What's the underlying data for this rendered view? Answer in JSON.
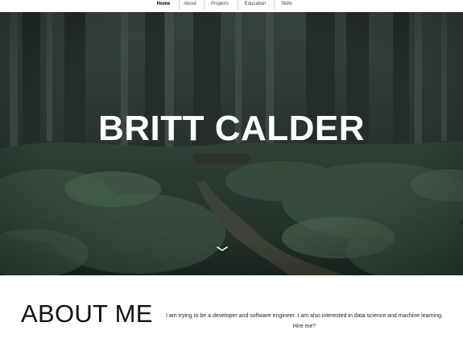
{
  "nav": {
    "items": [
      {
        "label": "Home",
        "active": true
      },
      {
        "label": "About",
        "active": false
      },
      {
        "label": "Projects",
        "active": false
      },
      {
        "label": "Education",
        "active": false
      },
      {
        "label": "Skills",
        "active": false
      }
    ]
  },
  "hero": {
    "title": "BRITT CALDER",
    "scroll_icon": "chevron-down-icon",
    "background": "forest trail photo"
  },
  "about": {
    "heading": "ABOUT ME",
    "text": "I am trying to be a developer and software engineer. I am also interested in data science and machine learning.",
    "hire_link": "Hire me?"
  },
  "colors": {
    "hero_overlay": "#1f2a25",
    "text_dark": "#111111",
    "nav_bg": "#ffffff"
  }
}
